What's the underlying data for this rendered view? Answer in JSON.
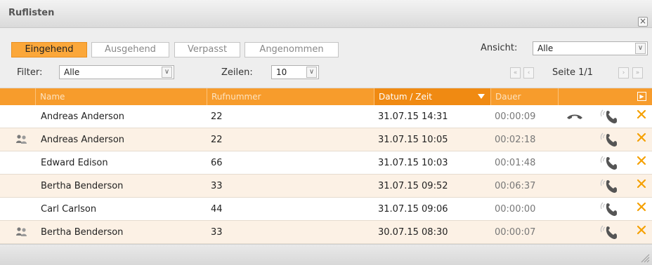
{
  "window": {
    "title": "Ruflisten",
    "close_symbol": "×"
  },
  "tabs": [
    {
      "label": "Eingehend",
      "active": true
    },
    {
      "label": "Ausgehend",
      "active": false
    },
    {
      "label": "Verpasst",
      "active": false
    },
    {
      "label": "Angenommen",
      "active": false
    }
  ],
  "view": {
    "label": "Ansicht:",
    "value": "Alle"
  },
  "filter": {
    "label": "Filter:",
    "value": "Alle"
  },
  "rows_per_page": {
    "label": "Zeilen:",
    "value": "10"
  },
  "pagination": {
    "text": "Seite 1/1"
  },
  "columns": {
    "name": "Name",
    "number": "Rufnummer",
    "datetime": "Datum / Zeit",
    "duration": "Dauer"
  },
  "colors": {
    "accent": "#f79c2c",
    "sorted_header": "#f08a12",
    "row_alt": "#fcf1e5",
    "delete": "#f5a000"
  },
  "calls": [
    {
      "name": "Andreas Anderson",
      "number": "22",
      "datetime": "31.07.15 14:31",
      "duration": "00:00:09",
      "contact_icon": false,
      "hangup_icon": true
    },
    {
      "name": "Andreas Anderson",
      "number": "22",
      "datetime": "31.07.15 10:05",
      "duration": "00:02:18",
      "contact_icon": true,
      "hangup_icon": false
    },
    {
      "name": "Edward Edison",
      "number": "66",
      "datetime": "31.07.15 10:03",
      "duration": "00:01:48",
      "contact_icon": false,
      "hangup_icon": false
    },
    {
      "name": "Bertha Benderson",
      "number": "33",
      "datetime": "31.07.15 09:52",
      "duration": "00:06:37",
      "contact_icon": false,
      "hangup_icon": false
    },
    {
      "name": "Carl Carlson",
      "number": "44",
      "datetime": "31.07.15 09:06",
      "duration": "00:00:00",
      "contact_icon": false,
      "hangup_icon": false
    },
    {
      "name": "Bertha Benderson",
      "number": "33",
      "datetime": "30.07.15 08:30",
      "duration": "00:00:07",
      "contact_icon": true,
      "hangup_icon": false
    }
  ]
}
